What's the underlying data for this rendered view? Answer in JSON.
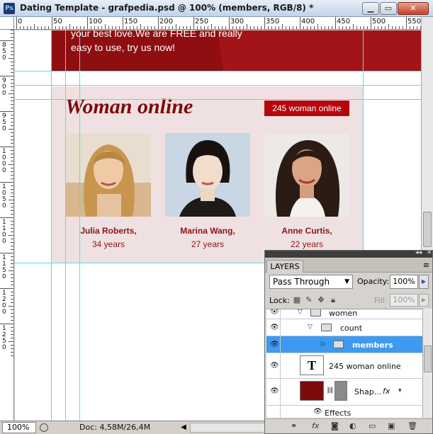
{
  "window": {
    "app_icon": "Ps",
    "title": "Dating Template - grafpedia.psd @ 100% (members, RGB/8) *",
    "minimize_glyph": "▁",
    "maximize_glyph": "▭",
    "close_glyph": "✕"
  },
  "ruler": {
    "top_labels": [
      "0",
      "50",
      "100",
      "150",
      "200",
      "250",
      "300",
      "350",
      "400",
      "450",
      "500",
      "550"
    ],
    "left_labels": [
      "0",
      "850",
      "900",
      "950",
      "1000",
      "1050",
      "1100",
      "1150",
      "1200",
      "1250"
    ]
  },
  "canvas": {
    "hero_lines": [
      "your best love.We are FREE and really",
      "easy to use, try us now!"
    ],
    "heading": "Woman online",
    "online_badge": "245 woman online",
    "members": [
      {
        "name": "Julia Roberts,",
        "age": "34 years"
      },
      {
        "name": "Marina Wang,",
        "age": "27 years"
      },
      {
        "name": "Anne Curtis,",
        "age": "22 years"
      }
    ],
    "colors": {
      "hero": "#8f0e12",
      "panel": "#efe1e1",
      "accent": "#b5060d",
      "text": "#8d1417",
      "guide": "#4de3e6"
    }
  },
  "statusbar": {
    "zoom": "100%",
    "doc_info": "Doc: 4,58M/26,4M"
  },
  "layers_panel": {
    "tab": "LAYERS",
    "blend_mode": "Pass Through",
    "opacity_label": "Opacity:",
    "opacity": "100%",
    "lock_label": "Lock:",
    "fill_label": "Fill:",
    "fill": "100%",
    "layers": [
      {
        "name": "women",
        "type": "group",
        "expanded": true
      },
      {
        "name": "count",
        "type": "group",
        "expanded": true
      },
      {
        "name": "members",
        "type": "group",
        "expanded": false,
        "selected": true
      },
      {
        "name": "245 woman online",
        "type": "text",
        "thumb": "T"
      },
      {
        "name": "Shap...",
        "type": "shape",
        "fx": "fx"
      },
      {
        "name": "Effects",
        "type": "effects"
      }
    ],
    "bottom_icons": [
      "link-icon",
      "fx-icon",
      "mask-icon",
      "adjustment-icon",
      "group-icon",
      "new-layer-icon",
      "trash-icon"
    ]
  }
}
